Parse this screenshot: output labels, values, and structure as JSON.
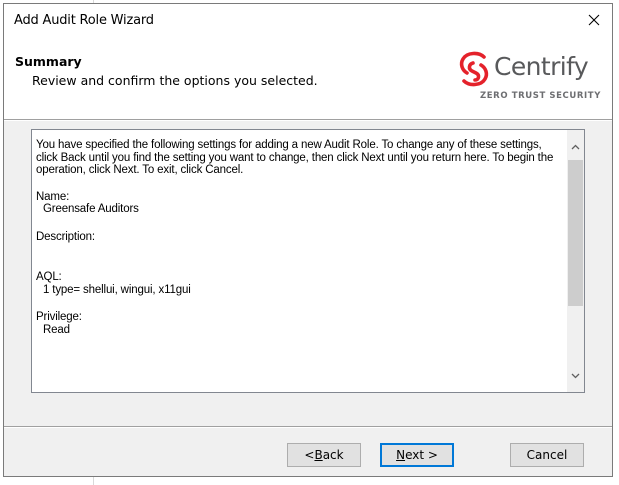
{
  "window": {
    "title": "Add Audit Role Wizard"
  },
  "header": {
    "title": "Summary",
    "subtitle": "Review and confirm the options you selected."
  },
  "logo": {
    "name": "Centrify",
    "tagline": "ZERO TRUST SECURITY",
    "brand_color": "#e4222b"
  },
  "summary": {
    "intro": "You have specified the following settings for adding a new Audit Role. To change any of these settings, click Back until you find the setting you want to change, then click Next until you return here. To begin the operation, click Next. To exit, click Cancel.",
    "fields": [
      {
        "label": "Name:",
        "value": "Greensafe Auditors"
      },
      {
        "label": "Description:",
        "value": ""
      },
      {
        "label": "AQL:",
        "value": "1 type= shellui, wingui, x11gui"
      },
      {
        "label": "Privilege:",
        "value": "Read"
      }
    ]
  },
  "buttons": {
    "back_prefix": "< ",
    "back_mnemonic": "B",
    "back_rest": "ack",
    "next_mnemonic": "N",
    "next_rest": "ext >",
    "cancel": "Cancel"
  },
  "colors": {
    "accent": "#0078d7"
  }
}
